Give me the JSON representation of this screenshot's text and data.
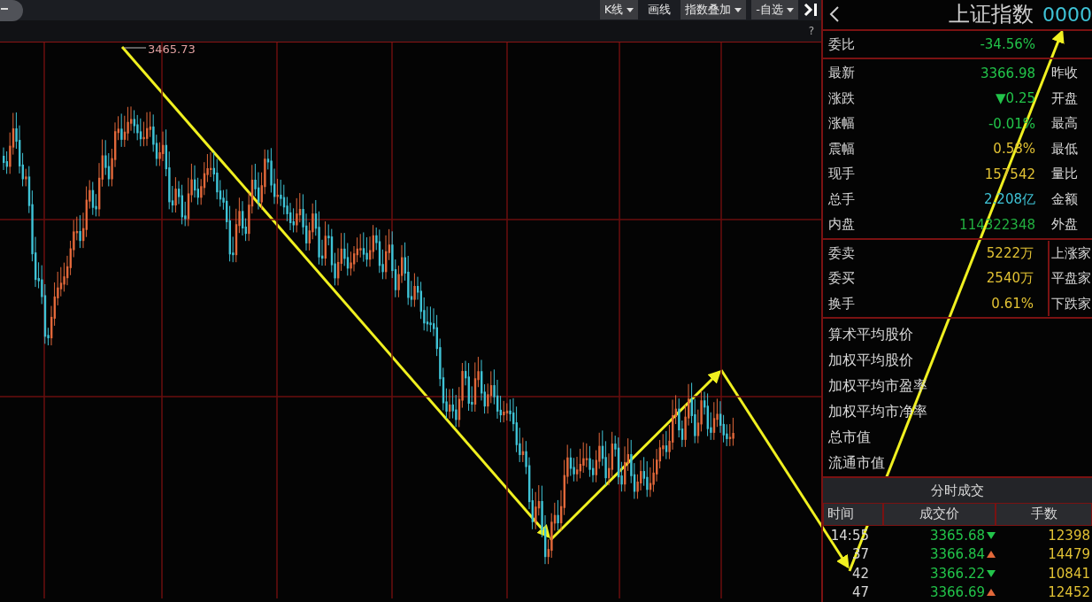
{
  "toolbar": {
    "buttons": [
      {
        "label": "K线",
        "dropdown": true
      },
      {
        "label": "画线",
        "dropdown": false
      },
      {
        "label": "指数叠加",
        "dropdown": true
      },
      {
        "label": "-自选",
        "dropdown": true
      }
    ],
    "help": "?"
  },
  "chart": {
    "high_label": "3465.73"
  },
  "quote": {
    "title": "上证指数",
    "code": "0000",
    "ratio": {
      "label": "委比",
      "value": "-34.56%",
      "color": "#22c44a"
    },
    "rows": [
      {
        "label": "最新",
        "value": "3366.98",
        "color": "#22c44a",
        "right": "昨收"
      },
      {
        "label": "涨跌",
        "value": "▼0.25",
        "color": "#22c44a",
        "right": "开盘"
      },
      {
        "label": "涨幅",
        "value": "-0.01%",
        "color": "#22c44a",
        "right": "最高"
      },
      {
        "label": "震幅",
        "value": "0.58%",
        "color": "#e2c234",
        "right": "最低"
      },
      {
        "label": "现手",
        "value": "157542",
        "color": "#e2c234",
        "right": "量比"
      },
      {
        "label": "总手",
        "value": "2.208亿",
        "color": "#3fc3d6",
        "right": "金额"
      },
      {
        "label": "内盘",
        "value": "114322348",
        "color": "#22b040",
        "right": "外盘"
      }
    ],
    "orders": [
      {
        "label": "委卖",
        "value": "5222万",
        "color": "#e2c234",
        "right": "上涨家"
      },
      {
        "label": "委买",
        "value": "2540万",
        "color": "#e2c234",
        "right": "平盘家"
      },
      {
        "label": "换手",
        "value": "0.61%",
        "color": "#e2c234",
        "right": "下跌家"
      }
    ],
    "stats": [
      "算术平均股价",
      "加权平均股价",
      "加权平均市盈率",
      "加权平均市净率",
      "总市值",
      "流通市值"
    ]
  },
  "trades": {
    "title": "分时成交",
    "columns": [
      "时间",
      "成交价",
      "手数"
    ],
    "rows": [
      {
        "time": "14:55",
        "price": "3365.68",
        "up": false,
        "volume": "12398"
      },
      {
        "time": "37",
        "price": "3366.84",
        "up": true,
        "volume": "14479"
      },
      {
        "time": "42",
        "price": "3366.22",
        "up": false,
        "volume": "10841"
      },
      {
        "time": "47",
        "price": "3366.69",
        "up": true,
        "volume": "12452"
      }
    ]
  }
}
